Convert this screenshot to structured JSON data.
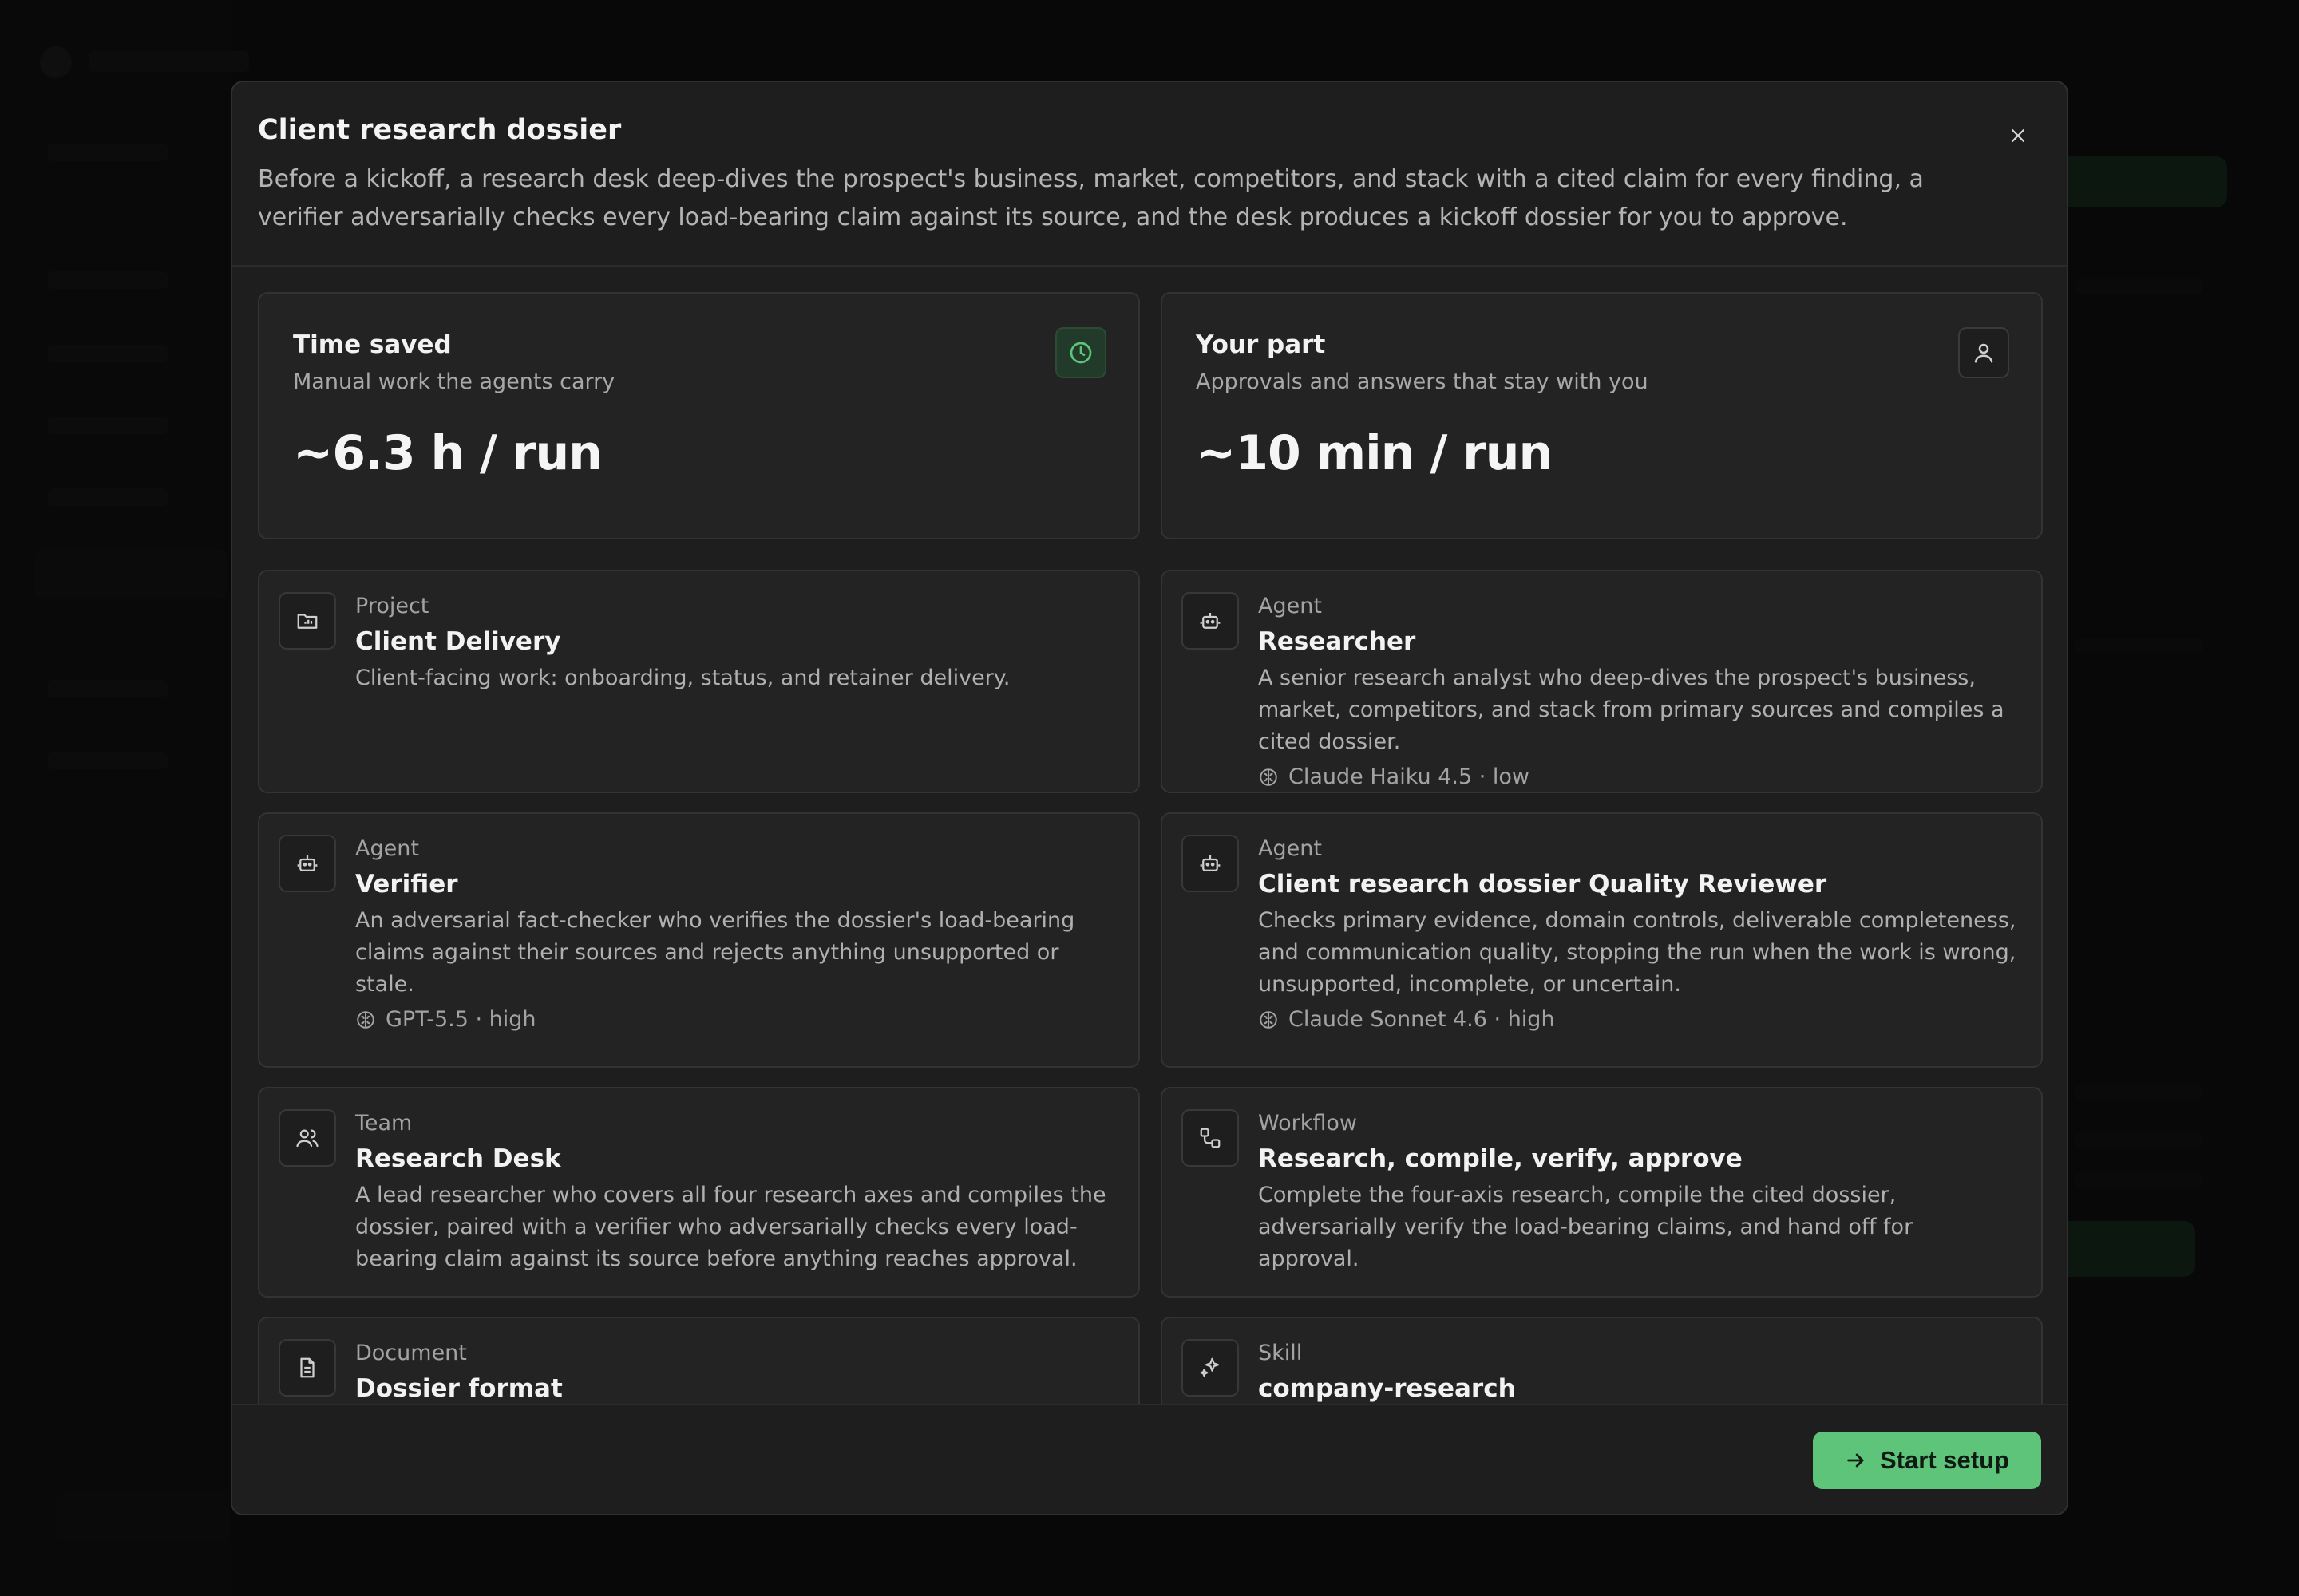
{
  "modal": {
    "title": "Client research dossier",
    "description": "Before a kickoff, a research desk deep-dives the prospect's business, market, competitors, and stack with a cited claim for every finding, a verifier adversarially checks every load-bearing claim against its source, and the desk produces a kickoff dossier for you to approve."
  },
  "stats": {
    "time_saved": {
      "title": "Time saved",
      "subtitle": "Manual work the agents carry",
      "value": "~6.3 h / run",
      "icon": "clock-icon"
    },
    "your_part": {
      "title": "Your part",
      "subtitle": "Approvals and answers that stay with you",
      "value": "~10 min / run",
      "icon": "user-icon"
    }
  },
  "items": [
    {
      "kind": "Project",
      "name": "Client Delivery",
      "description": "Client-facing work: onboarding, status, and retainer delivery.",
      "model": "",
      "icon": "folder-icon"
    },
    {
      "kind": "Agent",
      "name": "Researcher",
      "description": "A senior research analyst who deep-dives the prospect's business, market, competitors, and stack from primary sources and compiles a cited dossier.",
      "model": "Claude Haiku 4.5 · low",
      "icon": "bot-icon"
    },
    {
      "kind": "Agent",
      "name": "Verifier",
      "description": "An adversarial fact-checker who verifies the dossier's load-bearing claims against their sources and rejects anything unsupported or stale.",
      "model": "GPT-5.5 · high",
      "icon": "bot-icon"
    },
    {
      "kind": "Agent",
      "name": "Client research dossier Quality Reviewer",
      "description": "Checks primary evidence, domain controls, deliverable completeness, and communication quality, stopping the run when the work is wrong, unsupported, incomplete, or uncertain.",
      "model": "Claude Sonnet 4.6 · high",
      "icon": "bot-icon"
    },
    {
      "kind": "Team",
      "name": "Research Desk",
      "description": "A lead researcher who covers all four research axes and compiles the dossier, paired with a verifier who adversarially checks every load-bearing claim against its source before anything reaches approval.",
      "model": "",
      "icon": "users-icon"
    },
    {
      "kind": "Workflow",
      "name": "Research, compile, verify, approve",
      "description": "Complete the four-axis research, compile the cited dossier, adversarially verify the load-bearing claims, and hand off for approval.",
      "model": "",
      "icon": "workflow-icon"
    },
    {
      "kind": "Document",
      "name": "Dossier format",
      "description": "",
      "model": "",
      "icon": "document-icon"
    },
    {
      "kind": "Skill",
      "name": "company-research",
      "description": "",
      "model": "",
      "icon": "sparkle-icon"
    }
  ],
  "footer": {
    "start_label": "Start setup"
  },
  "colors": {
    "accent": "#5ec47a",
    "modal_bg": "#1e1e1e",
    "card_bg": "#232323"
  }
}
